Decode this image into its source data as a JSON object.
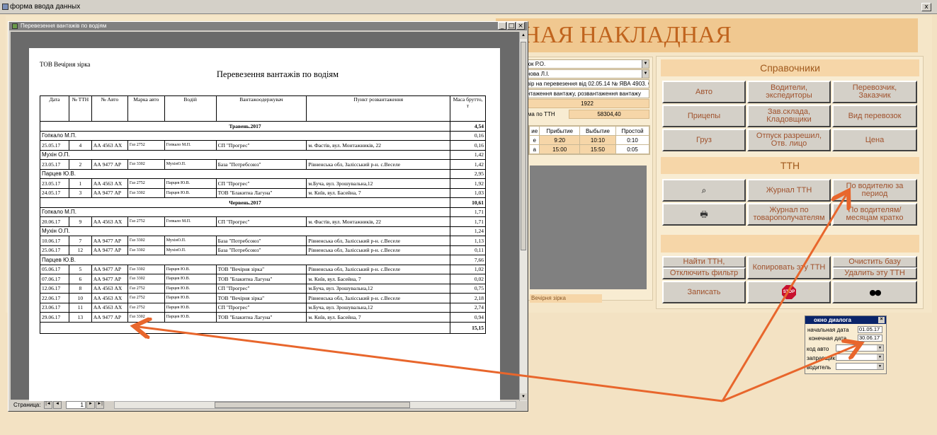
{
  "outer_window": {
    "title": "форма ввода данных",
    "close_label": "x"
  },
  "main_form": {
    "big_title": "НАЯ НАКЛАДНАЯ"
  },
  "middle": {
    "field1": "юк Р.О.",
    "field2": "нова Л.І.",
    "field3": "вір на перевезення від 02.05.14 № ЯВА 4903. С",
    "field4": "нтаження вантажу, розвантаження вантажу",
    "number": "1922",
    "sum_label": "ума по ТТН",
    "sum_value": "58304,40",
    "schedule": {
      "headers": [
        "ие",
        "Прибытие",
        "Выбытие",
        "Простой"
      ],
      "rows": [
        [
          "е",
          "9:20",
          "10:10",
          "0:10"
        ],
        [
          "а",
          "15:00",
          "15:50",
          "0:05"
        ]
      ]
    },
    "rights": "Вечірня зірка"
  },
  "right": {
    "spr_header": "Справочники",
    "spr_buttons": [
      "Авто",
      "Водители, экспедиторы",
      "Перевозчик, Заказчик",
      "Прицепы",
      "Зав.склада, Кладовщики",
      "Вид перевозок",
      "Груз",
      "Отпуск разрешил, Отв. лицо",
      "Цена"
    ],
    "ttn_header": "ТТН",
    "ttn_buttons": [
      "Журнал ТТН",
      "По водителю за период",
      "Журнал по товарополучателям",
      "По водителям/ месяцам кратко"
    ],
    "action_buttons": {
      "find": "Найти ТТН,",
      "unfilter": "Отключить фильтр",
      "copy": "Копировать эту ТТН",
      "clear": "Очистить базу",
      "delete": "Удалить эту ТТН",
      "save": "Записать",
      "stop": "STOP"
    },
    "icons": {
      "search": "search-icon",
      "print": "printer-icon",
      "binoculars": "binoculars-icon"
    }
  },
  "report": {
    "window_title": "Перевезення вантажів по водіям",
    "company": "ТОВ Вечірня зірка",
    "heading": "Перевезення вантажів по водіям",
    "columns": [
      "Дата",
      "№ ТТН",
      "№ Авто",
      "Марка авто",
      "Водій",
      "Вантажоодержувач",
      "Пункт розвантаження",
      "Маса брутто, т"
    ],
    "rows": [
      {
        "kind": "month",
        "label": "Травень.2017",
        "mass": "4,54"
      },
      {
        "kind": "driver",
        "label": "Гопкало М.П.",
        "mass": "0,16"
      },
      {
        "kind": "row",
        "cells": [
          "25.05.17",
          "4",
          "АА 4563 АХ",
          "Газ 2752",
          "Гопкало М.П.",
          "СП \"Прогрес\"",
          "м. Фастів, вул. Монтажників, 22",
          "0,16"
        ]
      },
      {
        "kind": "driver",
        "label": "Мухін О.П.",
        "mass": "1,42"
      },
      {
        "kind": "row",
        "cells": [
          "23.05.17",
          "2",
          "АА 9477 АР",
          "Газ 3302",
          "МухінО.П.",
          "База \"Потребсоюз\"",
          "Рівненська обл, Залісський р-н. с.Веселе",
          "1,42"
        ]
      },
      {
        "kind": "driver",
        "label": "Парцев Ю.В.",
        "mass": "2,95"
      },
      {
        "kind": "row",
        "cells": [
          "23.05.17",
          "1",
          "АА 4563 АХ",
          "Газ 2752",
          "Парцев Ю.В.",
          "СП \"Прогрес\"",
          "м.Буча, вул. Зрошувальна,12",
          "1,92"
        ]
      },
      {
        "kind": "row",
        "cells": [
          "24.05.17",
          "3",
          "АА 9477 АР",
          "Газ 3302",
          "Парцев Ю.В.",
          "ТОВ \"Блакитна Лагуна\"",
          "м. Київ, вул. Басейна, 7",
          "1,03"
        ]
      },
      {
        "kind": "month",
        "label": "Червень.2017",
        "mass": "10,61"
      },
      {
        "kind": "driver",
        "label": "Гопкало М.П.",
        "mass": "1,71"
      },
      {
        "kind": "row",
        "cells": [
          "20.06.17",
          "9",
          "АА 4563 АХ",
          "Газ 2752",
          "Гопкало М.П.",
          "СП \"Прогрес\"",
          "м. Фастів, вул. Монтажників, 22",
          "1,71"
        ]
      },
      {
        "kind": "driver",
        "label": "Мухін О.П.",
        "mass": "1,24"
      },
      {
        "kind": "row",
        "cells": [
          "10.06.17",
          "7",
          "АА 9477 АР",
          "Газ 3302",
          "МухінО.П.",
          "База \"Потребсоюз\"",
          "Рівненська обл, Залісський р-н. с.Веселе",
          "1,13"
        ]
      },
      {
        "kind": "row",
        "cells": [
          "25.06.17",
          "12",
          "АА 9477 АР",
          "Газ 3302",
          "МухінО.П.",
          "База \"Потребсоюз\"",
          "Рівненська обл, Залісський р-н. с.Веселе",
          "0,11"
        ]
      },
      {
        "kind": "driver",
        "label": "Парцев Ю.В.",
        "mass": "7,66"
      },
      {
        "kind": "row",
        "cells": [
          "05.06.17",
          "5",
          "АА 9477 АР",
          "Газ 3302",
          "Парцев Ю.В.",
          "ТОВ \"Вечірня зірка\"",
          "Рівненська обл, Залісський р-н. с.Веселе",
          "1,02"
        ]
      },
      {
        "kind": "row",
        "cells": [
          "07.06.17",
          "6",
          "АА 9477 АР",
          "Газ 3302",
          "Парцев Ю.В.",
          "ТОВ \"Блакитна Лагуна\"",
          "м. Київ, вул. Басейна, 7",
          "0,02"
        ]
      },
      {
        "kind": "row",
        "cells": [
          "12.06.17",
          "8",
          "АА 4563 АХ",
          "Газ 2752",
          "Парцев Ю.В.",
          "СП \"Прогрес\"",
          "м.Буча, вул. Зрошувальна,12",
          "0,75"
        ]
      },
      {
        "kind": "row",
        "cells": [
          "22.06.17",
          "10",
          "АА 4563 АХ",
          "Газ 2752",
          "Парцев Ю.В.",
          "ТОВ \"Вечірня зірка\"",
          "Рівненська обл, Залісський р-н. с.Веселе",
          "2,18"
        ]
      },
      {
        "kind": "row",
        "cells": [
          "23.06.17",
          "11",
          "АА 4563 АХ",
          "Газ 2752",
          "Парцев Ю.В.",
          "СП \"Прогрес\"",
          "м.Буча, вул. Зрошувальна,12",
          "2,74"
        ]
      },
      {
        "kind": "row",
        "cells": [
          "29.06.17",
          "13",
          "АА 9477 АР",
          "Газ 3302",
          "Парцев Ю.В.",
          "ТОВ \"Блакитна Лагуна\"",
          "м. Київ, вул. Басейна, 7",
          "0,94"
        ]
      },
      {
        "kind": "total",
        "mass": "15,15"
      }
    ],
    "page_label": "Страница:",
    "page_number": "1"
  },
  "dialog": {
    "title": "окно диалога",
    "start_label": "начальная дата",
    "start_value": "01.05.17",
    "end_label": "конечная дата",
    "end_value": "30.06.17",
    "auto_label": "код авто",
    "carrier_label": "заправщик",
    "driver_label": "водитель"
  },
  "colors": {
    "annotation_arrow": "#e8662c",
    "accent_text": "#a0522d",
    "background": "#f3e2c3"
  }
}
